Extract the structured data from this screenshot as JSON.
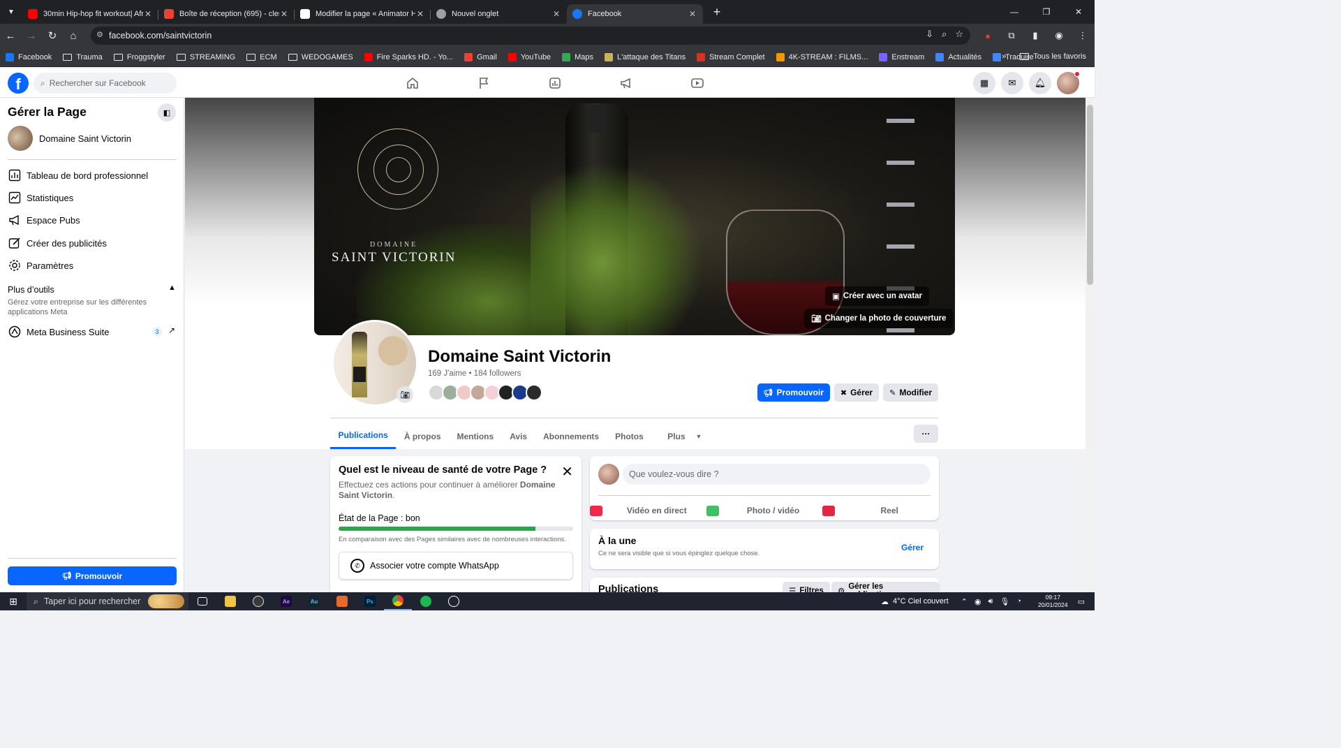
{
  "browser": {
    "tabs": [
      {
        "title": "30min Hip-hop fit workout| Afr",
        "favicon_color": "#ff0000"
      },
      {
        "title": "Boîte de réception (695) - clem",
        "favicon_color": "#ea4335"
      },
      {
        "title": "Modifier la page « Animator Ho",
        "favicon_color": "#ffffff"
      },
      {
        "title": "Nouvel onglet",
        "favicon_color": "#9aa0a6"
      },
      {
        "title": "Facebook",
        "favicon_color": "#1877f2"
      }
    ],
    "active_tab": 4,
    "url": "facebook.com/saintvictorin",
    "bookmarks": [
      {
        "label": "Facebook",
        "icon": "facebook-icon",
        "color": "#1877f2"
      },
      {
        "label": "Trauma",
        "icon": "folder-icon"
      },
      {
        "label": "Froggstyler",
        "icon": "folder-icon"
      },
      {
        "label": "STREAMING",
        "icon": "folder-icon"
      },
      {
        "label": "ECM",
        "icon": "folder-icon"
      },
      {
        "label": "WEDOGAMES",
        "icon": "folder-icon"
      },
      {
        "label": "Fire Sparks HD. - Yo...",
        "icon": "youtube-icon",
        "color": "#ff0000"
      },
      {
        "label": "Gmail",
        "icon": "gmail-icon",
        "color": "#ea4335"
      },
      {
        "label": "YouTube",
        "icon": "youtube-icon",
        "color": "#ff0000"
      },
      {
        "label": "Maps",
        "icon": "maps-icon",
        "color": "#34a853"
      },
      {
        "label": "L'attaque des Titans",
        "icon": "site-icon",
        "color": "#c7b35a"
      },
      {
        "label": "Stream Complet",
        "icon": "site-icon",
        "color": "#d93025"
      },
      {
        "label": "4K-STREAM : FILMS...",
        "icon": "site-icon",
        "color": "#f29900"
      },
      {
        "label": "Enstream",
        "icon": "site-icon",
        "color": "#7b61ff"
      },
      {
        "label": "Actualités",
        "icon": "news-icon",
        "color": "#4285f4"
      },
      {
        "label": "Traduire",
        "icon": "translate-icon",
        "color": "#4285f4"
      }
    ],
    "all_bookmarks_label": "Tous les favoris"
  },
  "facebook": {
    "search_placeholder": "Rechercher sur Facebook",
    "brand_color": "#0866ff"
  },
  "sidebar": {
    "title": "Gérer la Page",
    "page_name": "Domaine Saint Victorin",
    "items": [
      {
        "label": "Tableau de bord professionnel",
        "icon": "dashboard-icon"
      },
      {
        "label": "Statistiques",
        "icon": "insights-icon"
      },
      {
        "label": "Espace Pubs",
        "icon": "megaphone-icon"
      },
      {
        "label": "Créer des publicités",
        "icon": "edit-icon"
      },
      {
        "label": "Paramètres",
        "icon": "gear-icon"
      }
    ],
    "tools_title": "Plus d’outils",
    "tools_desc": "Gérez votre entreprise sur les différentes applications Meta",
    "meta_suite": "Meta Business Suite",
    "meta_badge": "3",
    "promote": "Promouvoir"
  },
  "cover": {
    "brand_small": "DOMAINE",
    "brand_big": "SAINT VICTORIN",
    "avatar_button": "Créer avec un avatar",
    "change_cover_button": "Changer la photo de couverture"
  },
  "profile": {
    "name": "Domaine Saint Victorin",
    "stats": "169 J'aime • 184 followers",
    "promote": "Promouvoir",
    "manage": "Gérer",
    "edit": "Modifier",
    "friend_colors": [
      "#d9d9d9",
      "#9bb09a",
      "#f0c9c9",
      "#c4a899",
      "#f2d0d5",
      "#222222",
      "#1b3a8a",
      "#2b2b2b"
    ]
  },
  "tabs": [
    "Publications",
    "À propos",
    "Mentions",
    "Avis",
    "Abonnements",
    "Photos",
    "Plus"
  ],
  "active_profile_tab": 0,
  "health": {
    "title": "Quel est le niveau de santé de votre Page ?",
    "desc_prefix": "Effectuez ces actions pour continuer à améliorer ",
    "desc_page": "Domaine Saint Victorin",
    "desc_suffix": ".",
    "state": "État de la Page : bon",
    "progress": 0.84,
    "compare": "En comparaison avec des Pages similaires avec de nombreuses interactions.",
    "whatsapp": "Associer votre compte WhatsApp"
  },
  "composer": {
    "placeholder": "Que voulez-vous dire ?",
    "live": "Vidéo en direct",
    "photo": "Photo / vidéo",
    "reel": "Reel"
  },
  "featured": {
    "title": "À la une",
    "subtitle": "Ce ne sera visible que si vous épinglez quelque chose.",
    "manage": "Gérer"
  },
  "posts": {
    "title": "Publications",
    "filters": "Filtres",
    "manage": "Gérer les publications"
  },
  "taskbar": {
    "search": "Taper ici pour rechercher",
    "weather": "4°C  Ciel couvert",
    "time": "09:17",
    "date": "20/01/2024"
  }
}
